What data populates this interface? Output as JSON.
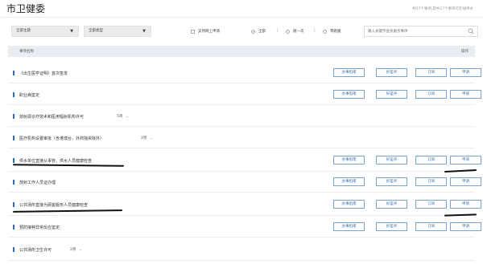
{
  "header": {
    "title": "市卫健委",
    "count_text": "共27个事项,其中27个事项可在线申办"
  },
  "filters": {
    "theme_select": "全部主题",
    "type_select": "全部类型",
    "online_checkbox_label": "支持网上申请",
    "radio_all": "全部",
    "radio_once": "跑一次",
    "radio_zero": "零跑腿",
    "search_placeholder": "输入关键字查找服务事项"
  },
  "table": {
    "col_name": "事项名称",
    "col_action": "操作",
    "button_labels": [
      "办事指南",
      "好差评",
      "订阅",
      "申请"
    ],
    "rows": [
      {
        "name": "《出生医学证明》首次签发",
        "badge": "",
        "buttons": true
      },
      {
        "name": "职业病鉴定",
        "badge": "",
        "buttons": true
      },
      {
        "name": "放射源诊疗技术和医用辐射机构许可",
        "badge": "5项",
        "buttons": false
      },
      {
        "name": "医疗机构设置审批（含港澳台，外商独资除外）",
        "badge": "2项",
        "buttons": false
      },
      {
        "name": "供水单位直接从事管、供水人员健康检查",
        "badge": "",
        "buttons": true
      },
      {
        "name": "放射工作人员证办理",
        "badge": "",
        "buttons": true
      },
      {
        "name": "公共场所直接为顾客服务人员健康检查",
        "badge": "",
        "buttons": true
      },
      {
        "name": "预防接种异常反应鉴定",
        "badge": "",
        "buttons": true
      },
      {
        "name": "公共场所卫生许可",
        "badge": "2项",
        "buttons": false
      }
    ]
  },
  "colors": {
    "accent": "#3b6fb6",
    "button_border": "#7aa3d6",
    "row_bar": "#2f6db5",
    "table_header_bg": "#e9eef5"
  }
}
